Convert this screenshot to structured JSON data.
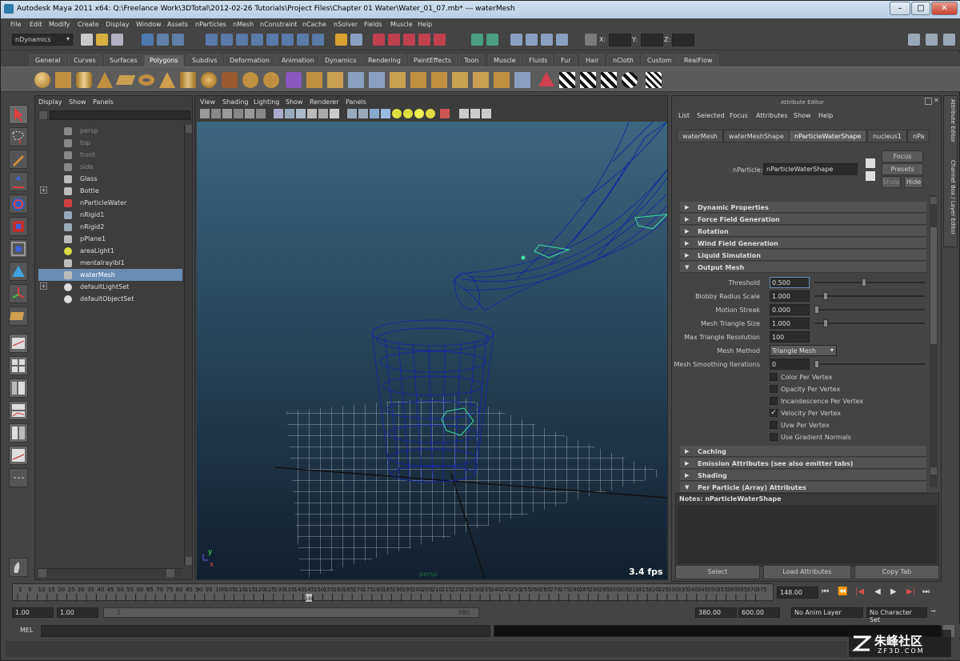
{
  "window": {
    "title": "Autodesk Maya 2011 x64: Q:\\Freelance Work\\3DTotal\\2012-02-26 Tutorials\\Project Files\\Chapter 01 Water\\Water_01_07.mb*   ---   waterMesh",
    "minimize": "–",
    "maximize": "□",
    "close": "✕"
  },
  "menu": [
    "File",
    "Edit",
    "Modify",
    "Create",
    "Display",
    "Window",
    "Assets",
    "nParticles",
    "nMesh",
    "nConstraint",
    "nCache",
    "nSolver",
    "Fields",
    "Muscle",
    "Help"
  ],
  "toolbar": {
    "menuset": "nDynamics",
    "x_label": "X:",
    "y_label": "Y:",
    "z_label": "Z:"
  },
  "shelf_tabs": [
    "General",
    "Curves",
    "Surfaces",
    "Polygons",
    "Subdivs",
    "Deformation",
    "Animation",
    "Dynamics",
    "Rendering",
    "PaintEffects",
    "Toon",
    "Muscle",
    "Fluids",
    "Fur",
    "Hair",
    "nCloth",
    "Custom",
    "RealFlow"
  ],
  "shelf_active": "Polygons",
  "outliner": {
    "menus": [
      "Display",
      "Show",
      "Panels"
    ],
    "items": [
      {
        "label": "persp",
        "icon": "camera-icon",
        "dim": true,
        "expand": ""
      },
      {
        "label": "top",
        "icon": "camera-icon",
        "dim": true,
        "expand": ""
      },
      {
        "label": "front",
        "icon": "camera-icon",
        "dim": true,
        "expand": ""
      },
      {
        "label": "side",
        "icon": "camera-icon",
        "dim": true,
        "expand": ""
      },
      {
        "label": "Glass",
        "icon": "mesh-icon",
        "dim": false,
        "expand": ""
      },
      {
        "label": "Bottle",
        "icon": "mesh-icon",
        "dim": false,
        "expand": "+"
      },
      {
        "label": "nParticleWater",
        "icon": "nparticle-icon",
        "dim": false,
        "expand": ""
      },
      {
        "label": "nRigid1",
        "icon": "nrigid-icon",
        "dim": false,
        "expand": ""
      },
      {
        "label": "nRigid2",
        "icon": "nrigid-icon",
        "dim": false,
        "expand": ""
      },
      {
        "label": "pPlane1",
        "icon": "mesh-icon",
        "dim": false,
        "expand": ""
      },
      {
        "label": "areaLight1",
        "icon": "light-icon",
        "dim": false,
        "expand": ""
      },
      {
        "label": "mentalrayIbl1",
        "icon": "ibl-icon",
        "dim": false,
        "expand": ""
      },
      {
        "label": "waterMesh",
        "icon": "mesh-icon",
        "dim": false,
        "expand": "",
        "selected": true
      },
      {
        "label": "defaultLightSet",
        "icon": "set-icon",
        "dim": false,
        "expand": "+"
      },
      {
        "label": "defaultObjectSet",
        "icon": "set-icon",
        "dim": false,
        "expand": ""
      }
    ]
  },
  "viewport": {
    "menus": [
      "View",
      "Shading",
      "Lighting",
      "Show",
      "Renderer",
      "Panels"
    ],
    "fps": "3.4 fps",
    "camera": "persp",
    "axis_y": "y",
    "axis_x": "x"
  },
  "attribute_editor": {
    "header": "Attribute Editor",
    "menus": [
      "List",
      "Selected",
      "Focus",
      "Attributes",
      "Show",
      "Help"
    ],
    "tabs": [
      "waterMesh",
      "waterMeshShape",
      "nParticleWaterShape",
      "nucleus1",
      "nPa"
    ],
    "active_tab": "nParticleWaterShape",
    "node_label": "nParticle:",
    "node_name": "nParticleWaterShape",
    "buttons": {
      "focus": "Focus",
      "presets": "Presets",
      "show": "Show",
      "hide": "Hide"
    },
    "sections_top": [
      {
        "label": "Dynamic Properties",
        "open": false
      },
      {
        "label": "Force Field Generation",
        "open": false
      },
      {
        "label": "Rotation",
        "open": false
      },
      {
        "label": "Wind Field Generation",
        "open": false
      },
      {
        "label": "Liquid Simulation",
        "open": false
      },
      {
        "label": "Output Mesh",
        "open": true
      }
    ],
    "attrs": [
      {
        "label": "Threshold",
        "value": "0.500",
        "slider": 0.45
      },
      {
        "label": "Blobby Radius Scale",
        "value": "1.000",
        "slider": 0.08
      },
      {
        "label": "Motion Streak",
        "value": "0.000",
        "slider": 0.0
      },
      {
        "label": "Mesh Triangle Size",
        "value": "1.000",
        "slider": 0.08
      },
      {
        "label": "Max Triangle Resolution",
        "value": "100",
        "slider": null
      }
    ],
    "mesh_method_label": "Mesh Method",
    "mesh_method": "Triangle Mesh",
    "smoothing_label": "Mesh Smoothing Iterations",
    "smoothing_value": "0",
    "checkboxes": [
      {
        "label": "Color Per Vertex",
        "checked": false
      },
      {
        "label": "Opacity Per Vertex",
        "checked": false
      },
      {
        "label": "Incandescence Per Vertex",
        "checked": false
      },
      {
        "label": "Velocity Per Vertex",
        "checked": true
      },
      {
        "label": "Uvw Per Vertex",
        "checked": false
      },
      {
        "label": "Use Gradient Normals",
        "checked": false
      }
    ],
    "sections_bottom": [
      {
        "label": "Caching",
        "open": false
      },
      {
        "label": "Emission Attributes (see also emitter tabs)",
        "open": false
      },
      {
        "label": "Shading",
        "open": false
      },
      {
        "label": "Per Particle (Array) Attributes",
        "open": true
      }
    ],
    "notes_label": "Notes:  nParticleWaterShape",
    "bottom_buttons": [
      "Select",
      "Load Attributes",
      "Copy Tab"
    ],
    "side_tabs": [
      "Attribute Editor",
      "Channel Box / Layer Editor"
    ]
  },
  "timeline": {
    "ticks": [
      "1",
      "5",
      "10",
      "15",
      "20",
      "25",
      "30",
      "35",
      "40",
      "45",
      "50",
      "55",
      "60",
      "65",
      "70",
      "75",
      "80",
      "85",
      "90",
      "95",
      "100",
      "105",
      "110",
      "115",
      "120",
      "125",
      "130",
      "135",
      "140",
      "145",
      "150",
      "155",
      "160",
      "165",
      "170",
      "175",
      "180",
      "185",
      "190",
      "195",
      "200",
      "205",
      "210",
      "215",
      "220",
      "225",
      "230",
      "235",
      "240",
      "245",
      "250",
      "255",
      "260",
      "265",
      "270",
      "275",
      "280",
      "285",
      "290",
      "295",
      "300",
      "305",
      "310",
      "315",
      "320",
      "325",
      "330",
      "335",
      "340",
      "345",
      "350",
      "355",
      "360",
      "365",
      "370",
      "375"
    ],
    "current_frame": "148",
    "frame_field": "148.00"
  },
  "range": {
    "start": "1.00",
    "inner_start": "1.00",
    "slider_start": "1",
    "slider_end": "380",
    "end": "380.00",
    "outer_end": "600.00",
    "anim_layer": "No Anim Layer",
    "char_set": "No Character Set"
  },
  "cmd": {
    "label": "MEL"
  },
  "watermark": {
    "brand": "朱峰社区",
    "url": "ZF3D.COM"
  }
}
